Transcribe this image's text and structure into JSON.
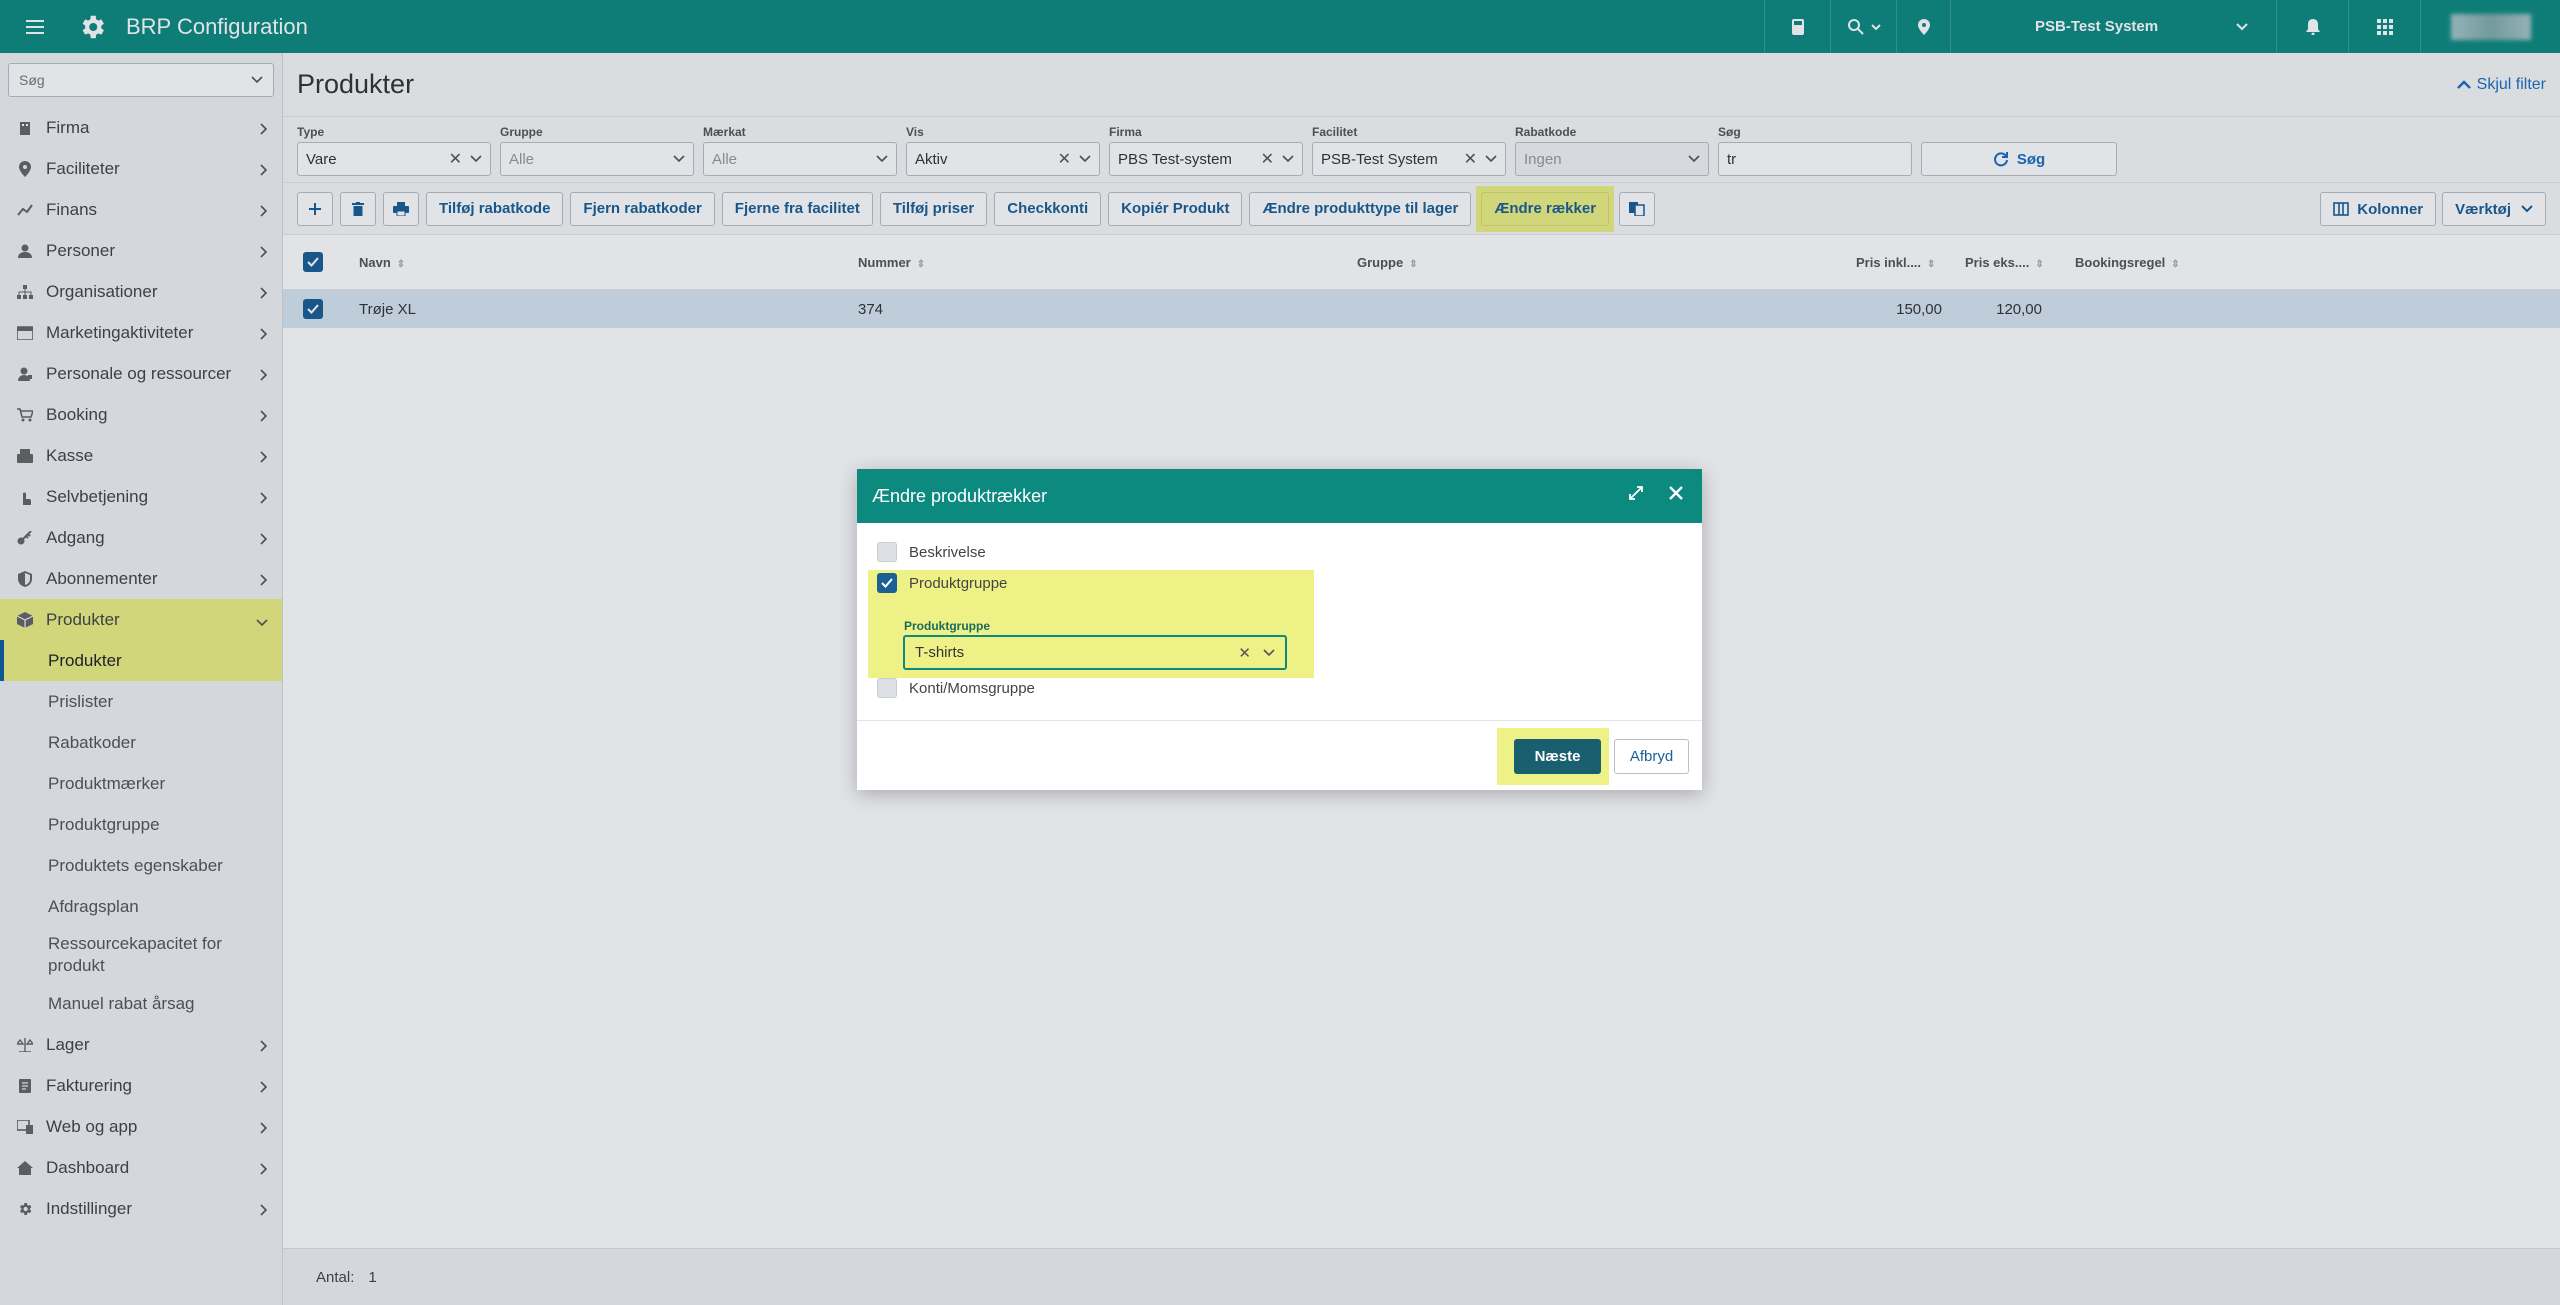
{
  "app": {
    "title": "BRP Configuration",
    "system": "PSB-Test System"
  },
  "sidebar": {
    "search_placeholder": "Søg",
    "items": [
      {
        "label": "Firma",
        "icon": "building-icon"
      },
      {
        "label": "Faciliteter",
        "icon": "location-pin-icon"
      },
      {
        "label": "Finans",
        "icon": "trend-line-icon"
      },
      {
        "label": "Personer",
        "icon": "person-icon"
      },
      {
        "label": "Organisationer",
        "icon": "hierarchy-icon"
      },
      {
        "label": "Marketingaktiviteter",
        "icon": "calendar-icon"
      },
      {
        "label": "Personale og ressourcer",
        "icon": "staff-icon"
      },
      {
        "label": "Booking",
        "icon": "cart-icon"
      },
      {
        "label": "Kasse",
        "icon": "register-icon"
      },
      {
        "label": "Selvbetjening",
        "icon": "touch-icon"
      },
      {
        "label": "Adgang",
        "icon": "key-icon"
      },
      {
        "label": "Abonnementer",
        "icon": "shield-icon"
      },
      {
        "label": "Produkter",
        "icon": "box-icon"
      }
    ],
    "sub_items": [
      "Produkter",
      "Prislister",
      "Rabatkoder",
      "Produktmærker",
      "Produktgruppe",
      "Produktets egenskaber",
      "Afdragsplan",
      "Ressourcekapacitet for produkt",
      "Manuel rabat årsag"
    ],
    "items_after": [
      {
        "label": "Lager",
        "icon": "scale-icon"
      },
      {
        "label": "Fakturering",
        "icon": "invoice-icon"
      },
      {
        "label": "Web og app",
        "icon": "web-icon"
      },
      {
        "label": "Dashboard",
        "icon": "home-icon"
      },
      {
        "label": "Indstillinger",
        "icon": "gear-icon"
      }
    ]
  },
  "page": {
    "title": "Produkter",
    "hide_filter": "Skjul filter"
  },
  "filters": {
    "type": {
      "label": "Type",
      "value": "Vare"
    },
    "gruppe": {
      "label": "Gruppe",
      "placeholder": "Alle"
    },
    "maerkat": {
      "label": "Mærkat",
      "placeholder": "Alle"
    },
    "vis": {
      "label": "Vis",
      "value": "Aktiv"
    },
    "firma": {
      "label": "Firma",
      "value": "PBS Test-system"
    },
    "facilitet": {
      "label": "Facilitet",
      "value": "PSB-Test System"
    },
    "rabatkode": {
      "label": "Rabatkode",
      "placeholder": "Ingen"
    },
    "soeg": {
      "label": "Søg",
      "value": "tr"
    },
    "search_button": "Søg"
  },
  "toolbar": {
    "add_rabatkode": "Tilføj rabatkode",
    "remove_rabatkoder": "Fjern rabatkoder",
    "remove_facilitet": "Fjerne fra facilitet",
    "add_priser": "Tilføj priser",
    "checkkonti": "Checkkonti",
    "copy_product": "Kopiér Produkt",
    "change_type": "Ændre produkttype til lager",
    "change_rows": "Ændre rækker",
    "columns": "Kolonner",
    "tools": "Værktøj"
  },
  "grid": {
    "headers": {
      "name": "Navn",
      "number": "Nummer",
      "group": "Gruppe",
      "price_incl": "Pris inkl....",
      "price_excl": "Pris eks....",
      "booking_rule": "Bookingsregel"
    },
    "rows": [
      {
        "name": "Trøje XL",
        "number": "374",
        "group": "",
        "price_incl": "150,00",
        "price_excl": "120,00",
        "booking_rule": ""
      }
    ]
  },
  "footer": {
    "count_label": "Antal:",
    "count": "1"
  },
  "modal": {
    "title": "Ændre produktrækker",
    "options": {
      "beskrivelse": "Beskrivelse",
      "produktgruppe": "Produktgruppe",
      "konti": "Konti/Momsgruppe"
    },
    "field_label": "Produktgruppe",
    "field_value": "T-shirts",
    "next": "Næste",
    "cancel": "Afbryd"
  }
}
